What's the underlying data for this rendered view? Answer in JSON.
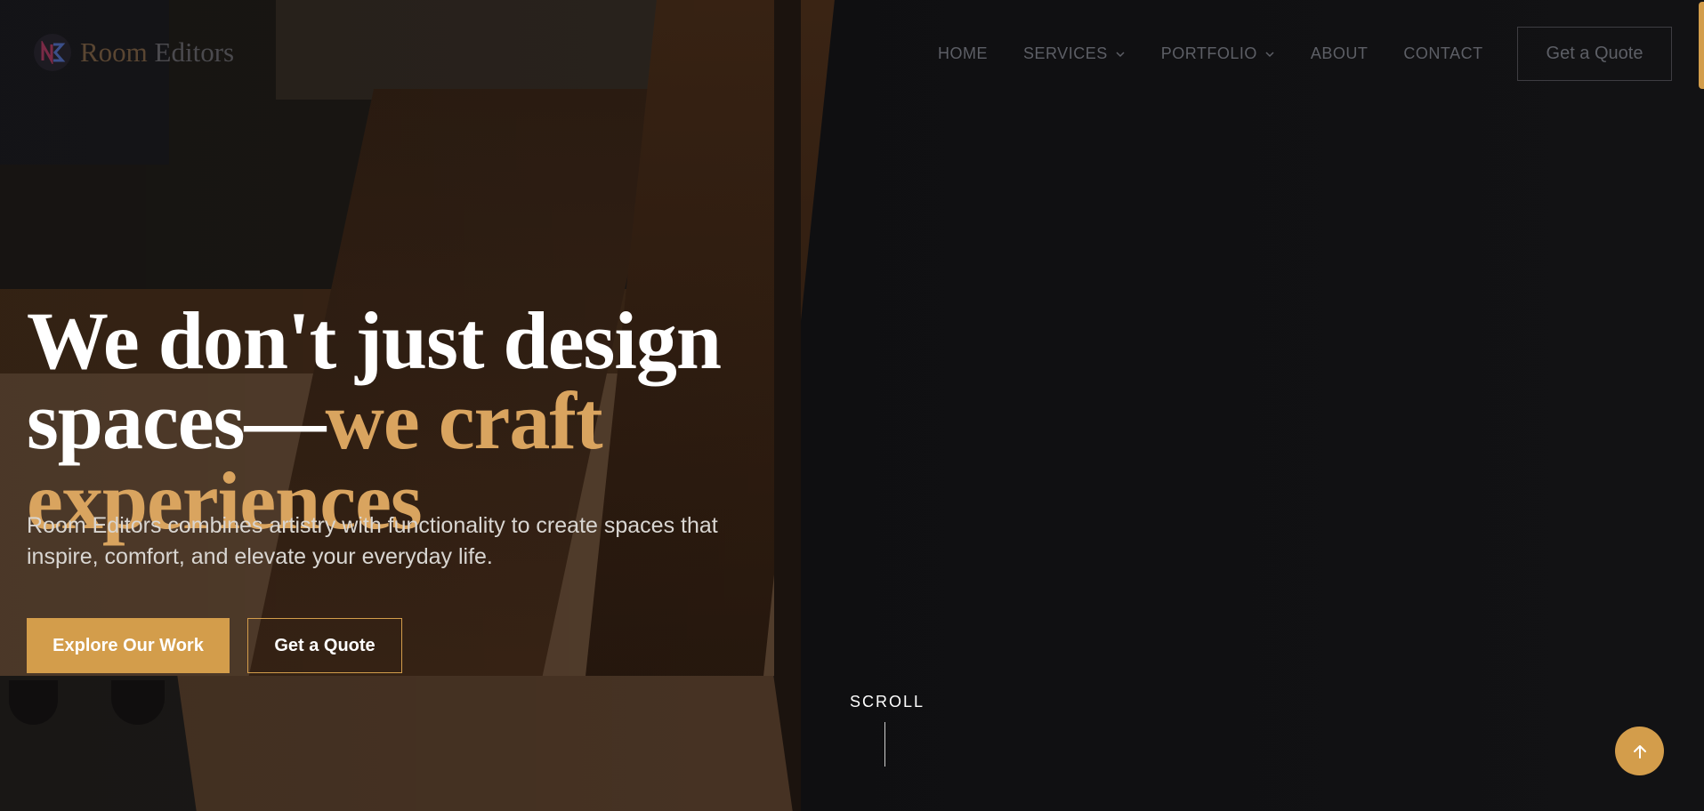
{
  "brand": {
    "name_part1": "Room",
    "name_part2": "Editors"
  },
  "nav": {
    "items": [
      {
        "label": "HOME",
        "has_dropdown": false
      },
      {
        "label": "SERVICES",
        "has_dropdown": true
      },
      {
        "label": "PORTFOLIO",
        "has_dropdown": true
      },
      {
        "label": "ABOUT",
        "has_dropdown": false
      },
      {
        "label": "CONTACT",
        "has_dropdown": false
      }
    ],
    "cta_label": "Get a Quote"
  },
  "hero": {
    "title_line1": "We don't just design",
    "title_line2_plain": "spaces—",
    "title_line2_accent": "we craft",
    "title_line3_accent": "experiences",
    "subtitle": "Room Editors combines artistry with functionality to create spaces that inspire, comfort, and elevate your everyday life.",
    "primary_button": "Explore Our Work",
    "secondary_button": "Get a Quote"
  },
  "scroll": {
    "label": "SCROLL"
  },
  "icons": {
    "dropdown": "chevron-down-icon",
    "back_to_top": "arrow-up-icon",
    "logo": "logo-icon"
  },
  "colors": {
    "accent": "#d39d4b",
    "accent_text": "#d9a45f",
    "background": "#111113",
    "nav_text": "#5d5f66"
  }
}
